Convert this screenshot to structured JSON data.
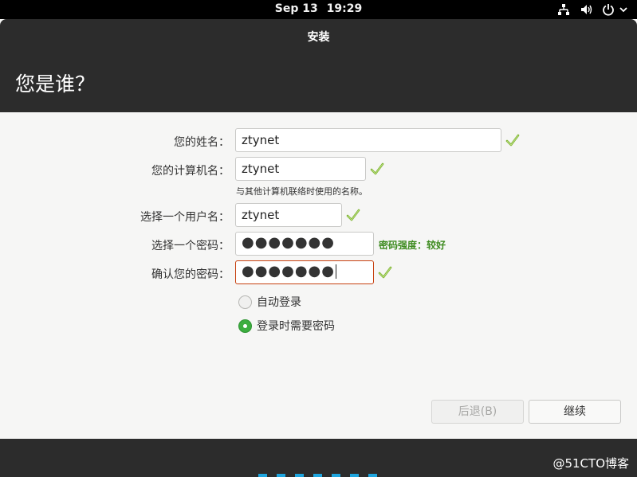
{
  "topbar": {
    "date": "Sep 13",
    "time": "19:29",
    "icons": [
      "network-icon",
      "volume-icon",
      "power-icon",
      "chevron-down-icon"
    ]
  },
  "window": {
    "title": "安装",
    "page_title": "您是谁？"
  },
  "form": {
    "name_label": "您的姓名：",
    "name_value": "ztynet",
    "computer_label": "您的计算机名：",
    "computer_value": "ztynet",
    "computer_hint": "与其他计算机联络时使用的名称。",
    "username_label": "选择一个用户名：",
    "username_value": "ztynet",
    "password_label": "选择一个密码：",
    "password_value": "●●●●●●●",
    "password_strength": "密码强度：较好",
    "confirm_label": "确认您的密码：",
    "confirm_value": "●●●●●●●",
    "auto_login_label": "自动登录",
    "require_password_label": "登录时需要密码",
    "selected_option": "require_password"
  },
  "buttons": {
    "back_label": "后退(B)",
    "continue_label": "继续"
  },
  "watermark": "@51CTO博客",
  "colors": {
    "accent": "#3cae3f",
    "focus_border": "#c7400f",
    "strength_text": "#3d8b1f",
    "progress": "#1ea5de"
  }
}
